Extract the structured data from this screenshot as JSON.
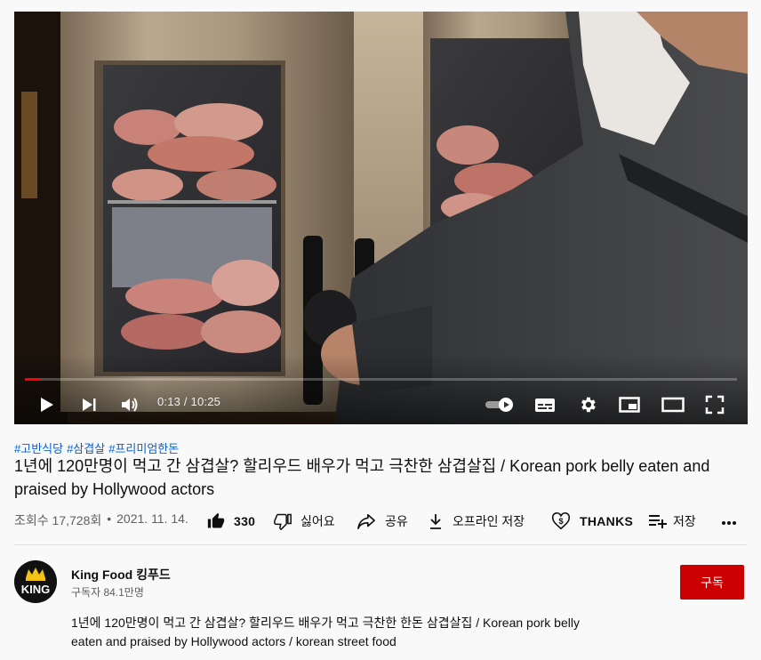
{
  "player": {
    "time_display": "0:13 / 10:25",
    "progress_fraction": 0.021
  },
  "hashtags": [
    "#고반식당",
    "#삼겹살",
    "#프리미엄한돈"
  ],
  "video": {
    "title": "1년에 120만명이 먹고 간 삼겹살? 할리우드 배우가 먹고 극찬한 삼겹살집 / Korean pork belly eaten and praised by Hollywood actors",
    "views": "조회수 17,728회",
    "date": "2021. 11. 14."
  },
  "actions": {
    "like_count": "330",
    "dislike_label": "싫어요",
    "share_label": "공유",
    "download_label": "오프라인 저장",
    "thanks_label": "THANKS",
    "save_label": "저장"
  },
  "channel": {
    "name": "King Food 킹푸드",
    "subscribers": "구독자 84.1만명",
    "avatar_text": "KING",
    "subscribe_label": "구독"
  },
  "description": {
    "line1": "1년에 120만명이 먹고 간 삼겹살? 할리우드 배우가 먹고 극찬한 한돈 삼겹살집 / Korean pork belly",
    "line2": "eaten and praised by Hollywood actors / korean street food"
  },
  "colors": {
    "accent_red": "#cc0000",
    "progress_red": "#ff0000",
    "link_blue": "#065fd4"
  }
}
